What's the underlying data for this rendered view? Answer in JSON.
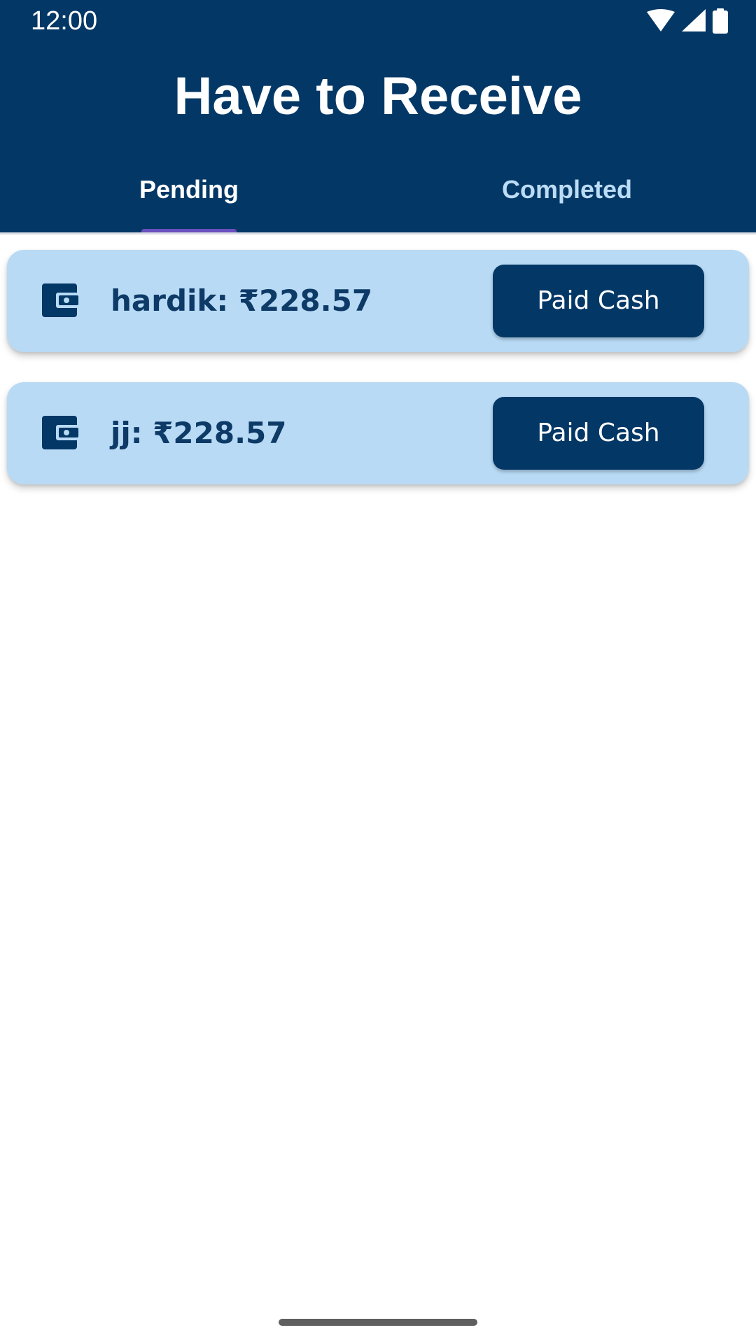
{
  "status_bar": {
    "time": "12:00",
    "icons": [
      "wifi-icon",
      "cellular-signal-icon",
      "battery-icon"
    ]
  },
  "header": {
    "title": "Have to Receive"
  },
  "tabs": [
    {
      "label": "Pending",
      "active": true
    },
    {
      "label": "Completed",
      "active": false
    }
  ],
  "receivables": [
    {
      "text": "hardik: ₹228.57",
      "icon": "wallet-icon",
      "action_label": "Paid Cash"
    },
    {
      "text": "jj: ₹228.57",
      "icon": "wallet-icon",
      "action_label": "Paid Cash"
    }
  ],
  "colors": {
    "header_bg": "#033766",
    "card_bg": "#b8daf5",
    "button_bg": "#033766",
    "tab_indicator": "#6a4fbf",
    "card_text": "#0d3a66"
  }
}
